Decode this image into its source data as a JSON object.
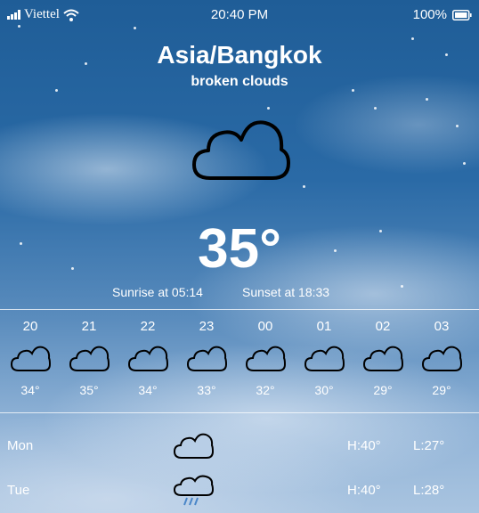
{
  "status_bar": {
    "carrier": "Viettel",
    "time": "20:40 PM",
    "battery": "100%"
  },
  "location": {
    "city": "Asia/Bangkok",
    "condition": "broken clouds",
    "icon": "cloud-icon"
  },
  "current": {
    "temperature": "35°",
    "sunrise": "Sunrise at 05:14",
    "sunset": "Sunset at 18:33"
  },
  "hourly": [
    {
      "hour": "20",
      "temp": "34°",
      "icon": "cloud-icon"
    },
    {
      "hour": "21",
      "temp": "35°",
      "icon": "cloud-icon"
    },
    {
      "hour": "22",
      "temp": "34°",
      "icon": "cloud-icon"
    },
    {
      "hour": "23",
      "temp": "33°",
      "icon": "cloud-icon"
    },
    {
      "hour": "00",
      "temp": "32°",
      "icon": "cloud-icon"
    },
    {
      "hour": "01",
      "temp": "30°",
      "icon": "cloud-icon"
    },
    {
      "hour": "02",
      "temp": "29°",
      "icon": "cloud-icon"
    },
    {
      "hour": "03",
      "temp": "29°",
      "icon": "cloud-icon"
    }
  ],
  "daily": [
    {
      "day": "Mon",
      "high": "H:40°",
      "low": "L:27°",
      "icon": "cloud-icon"
    },
    {
      "day": "Tue",
      "high": "H:40°",
      "low": "L:28°",
      "icon": "rain-cloud-icon"
    }
  ]
}
